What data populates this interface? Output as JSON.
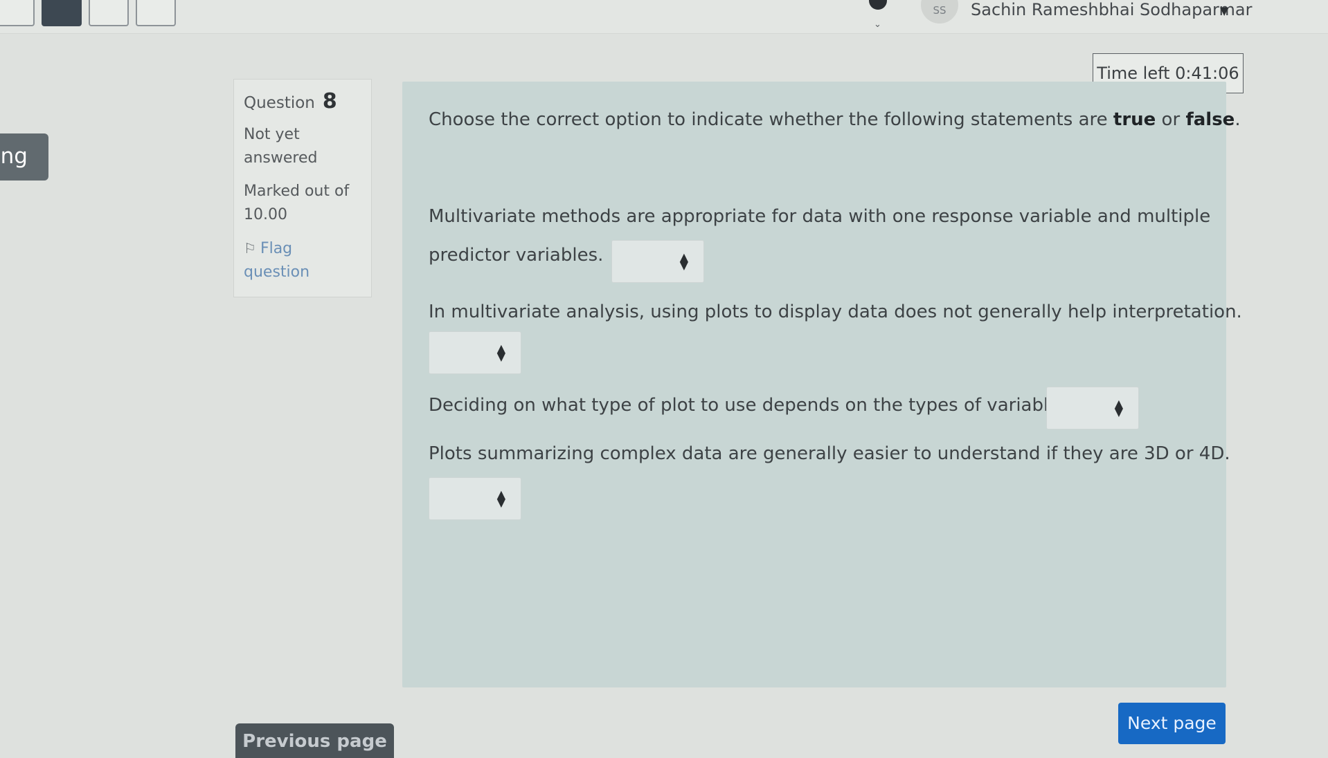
{
  "header": {
    "nav_boxes": [
      "",
      "",
      "",
      ""
    ],
    "avatar_initials": "SS",
    "user_name": "Sachin Rameshbhai Sodhaparmar",
    "user_chevron": "✔"
  },
  "sidebar": {
    "tab_label": "ing"
  },
  "timer": {
    "label": "Time left 0:41:06"
  },
  "question_info": {
    "question_label": "Question",
    "question_number": "8",
    "state_line1": "Not yet",
    "state_line2": "answered",
    "grade_line1": "Marked out of",
    "grade_line2": "10.00",
    "flag_line1": "Flag",
    "flag_line2": "question"
  },
  "question": {
    "intro_prefix": "Choose the correct option to indicate whether the following statements are ",
    "intro_true": "true",
    "intro_or": " or ",
    "intro_false": "false",
    "intro_suffix": ".",
    "statements": [
      {
        "line1": "Multivariate methods are appropriate for data with one response variable and multiple",
        "line2": "predictor variables.",
        "selected": ""
      },
      {
        "line1": "In multivariate analysis, using plots to display data does not generally help interpretation.",
        "selected": ""
      },
      {
        "line1": "Deciding on what type of plot to use depends on the types of variables.",
        "selected": ""
      },
      {
        "line1": "Plots summarizing complex data are generally easier to understand if they are 3D or 4D.",
        "selected": ""
      }
    ]
  },
  "footer": {
    "previous_label": "Previous page",
    "next_label": "Next page"
  }
}
